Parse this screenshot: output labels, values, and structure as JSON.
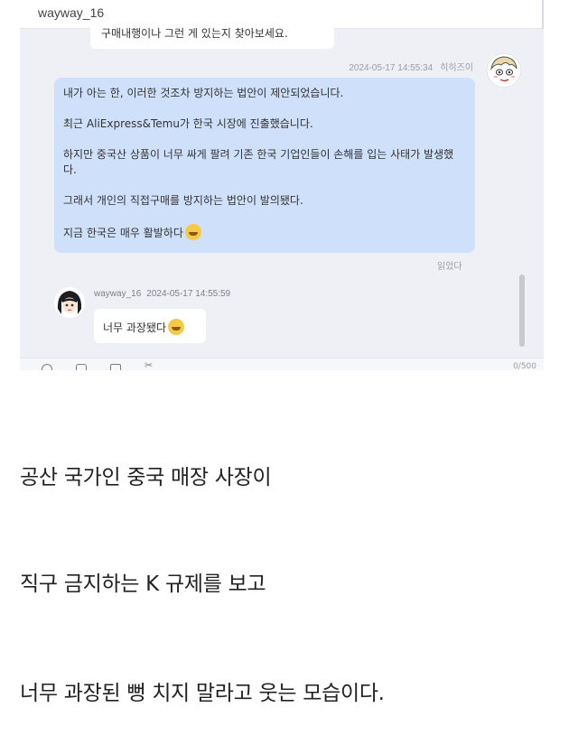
{
  "chat": {
    "header_title": "wayway_16",
    "clipped_message": "구매내행이나 그런 게 있는지 찾아보세요.",
    "outgoing": {
      "timestamp": "2024-05-17 14:55:34",
      "sender": "히히즈이",
      "paragraphs": [
        "내가 아는 한, 이러한 것조차 방지하는 법안이 제안되었습니다.",
        "최근 AliExpress&Temu가 한국 시장에 진출했습니다.",
        "하지만 중국산 상품이 너무 싸게 팔려 기존 한국 기업인들이 손해를 입는 사태가 발생했다.",
        "그래서 개인의 직접구매를 방지하는 법안이 발의됐다.",
        "지금 한국은 매우 활발하다"
      ],
      "last_emoji": "crying-laughing-face",
      "read_label": "읽었다"
    },
    "incoming": {
      "sender": "wayway_16",
      "timestamp": "2024-05-17 14:55:59",
      "message": "너무 과장됐다",
      "emoji": "laughing-face"
    },
    "char_count": "0/500"
  },
  "captions": [
    "공산 국가인 중국 매장 사장이",
    "직구 금지하는 K 규제를 보고",
    "너무 과장된 뻥 치지 말라고 웃는 모습이다."
  ],
  "colors": {
    "outgoing_bubble": "#cfe0fb",
    "incoming_bubble": "#ffffff",
    "chat_background": "#eef0f5"
  }
}
